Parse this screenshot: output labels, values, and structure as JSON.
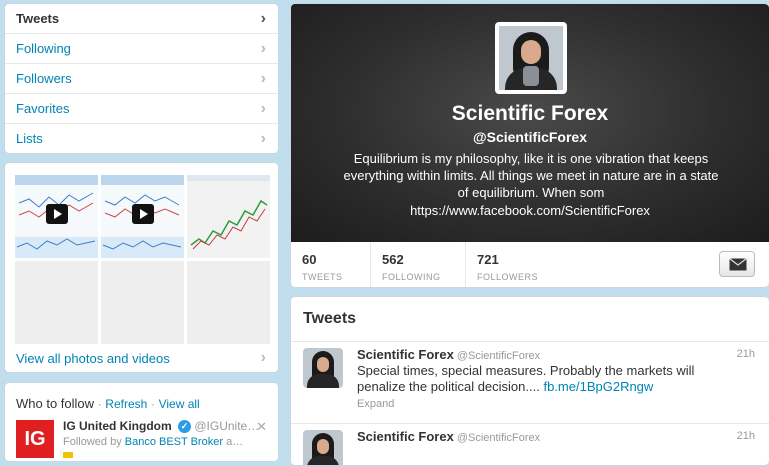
{
  "nav": {
    "items": [
      {
        "label": "Tweets"
      },
      {
        "label": "Following"
      },
      {
        "label": "Followers"
      },
      {
        "label": "Favorites"
      },
      {
        "label": "Lists"
      }
    ]
  },
  "media": {
    "view_all_label": "View all photos and videos"
  },
  "who_to_follow": {
    "title": "Who to follow",
    "separator": "·",
    "refresh_label": "Refresh",
    "view_all_label": "View all",
    "suggestion": {
      "logo_text": "IG",
      "name": "IG United Kingdom",
      "handle": "@IGUnite…",
      "followed_by_prefix": "Followed by",
      "followed_by_name": "Banco BEST Broker",
      "followed_by_suffix": "a…",
      "close_glyph": "✕"
    }
  },
  "profile": {
    "name": "Scientific Forex",
    "handle": "@ScientificForex",
    "bio": "Equilibrium is my philosophy, like it is one vibration that keeps everything within limits. All things we meet in nature are in a state of equilibrium. When som",
    "url": "https://www.facebook.com/ScientificForex",
    "stats": [
      {
        "value": "60",
        "label": "TWEETS"
      },
      {
        "value": "562",
        "label": "FOLLOWING"
      },
      {
        "value": "721",
        "label": "FOLLOWERS"
      }
    ]
  },
  "tweets": {
    "title": "Tweets",
    "items": [
      {
        "name": "Scientific Forex",
        "handle": "@ScientificForex",
        "time": "21h",
        "text": "Special times, special measures. Probably the markets will penalize the political decision....",
        "link": "fb.me/1BpG2Rngw",
        "expand": "Expand"
      },
      {
        "name": "Scientific Forex",
        "handle": "@ScientificForex",
        "time": "21h"
      }
    ]
  },
  "colors": {
    "link": "#0084b4",
    "background": "#c0deed",
    "header_dark": "#2e2e2e"
  },
  "icons": {
    "chevron": "chevron-right-icon",
    "verified": "verified-badge-icon",
    "envelope": "envelope-icon",
    "play": "play-icon"
  }
}
